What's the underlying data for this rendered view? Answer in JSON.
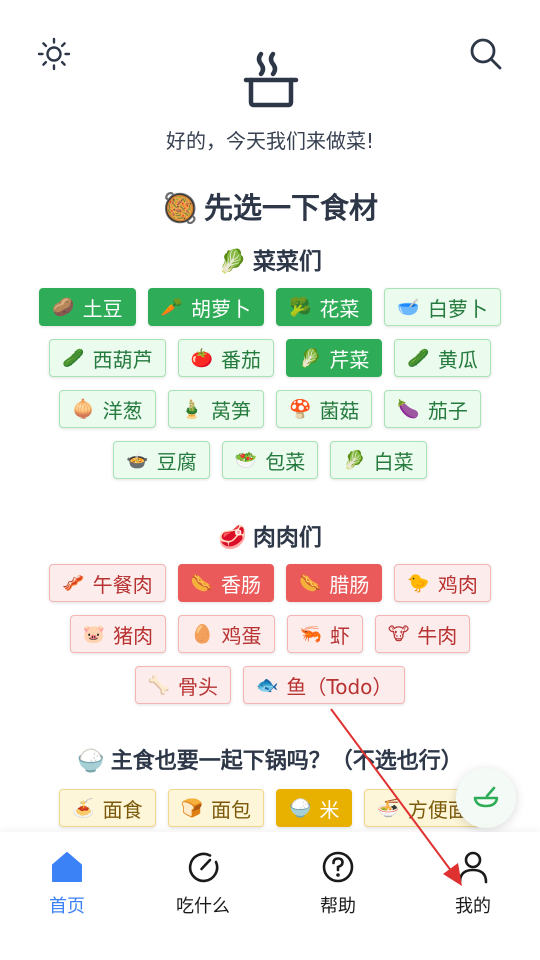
{
  "app": {
    "subtitle": "好的，今天我们来做菜!",
    "choose_title": "先选一下食材",
    "choose_emoji": "🥘"
  },
  "icons": {
    "top_left": "sun-icon",
    "top_right": "search-icon",
    "logo": "cooking-pot-icon",
    "fab": "bowl-icon"
  },
  "sections": {
    "veg": {
      "title": "菜菜们",
      "emoji": "🥬",
      "rows": [
        [
          {
            "emoji": "🥔",
            "label": "土豆",
            "selected": true
          },
          {
            "emoji": "🥕",
            "label": "胡萝卜",
            "selected": true
          },
          {
            "emoji": "🥦",
            "label": "花菜",
            "selected": true
          },
          {
            "emoji": "🥣",
            "label": "白萝卜",
            "selected": false
          }
        ],
        [
          {
            "emoji": "🥒",
            "label": "西葫芦",
            "selected": false
          },
          {
            "emoji": "🍅",
            "label": "番茄",
            "selected": false
          },
          {
            "emoji": "🥬",
            "label": "芹菜",
            "selected": true
          },
          {
            "emoji": "🥒",
            "label": "黄瓜",
            "selected": false
          }
        ],
        [
          {
            "emoji": "🧅",
            "label": "洋葱",
            "selected": false
          },
          {
            "emoji": "🎍",
            "label": "莴笋",
            "selected": false
          },
          {
            "emoji": "🍄",
            "label": "菌菇",
            "selected": false
          },
          {
            "emoji": "🍆",
            "label": "茄子",
            "selected": false
          }
        ],
        [
          {
            "emoji": "🍲",
            "label": "豆腐",
            "selected": false
          },
          {
            "emoji": "🥗",
            "label": "包菜",
            "selected": false
          },
          {
            "emoji": "🥬",
            "label": "白菜",
            "selected": false
          }
        ]
      ]
    },
    "meat": {
      "title": "肉肉们",
      "emoji": "🥩",
      "rows": [
        [
          {
            "emoji": "🥓",
            "label": "午餐肉",
            "selected": false
          },
          {
            "emoji": "🌭",
            "label": "香肠",
            "selected": true
          },
          {
            "emoji": "🌭",
            "label": "腊肠",
            "selected": true
          },
          {
            "emoji": "🐤",
            "label": "鸡肉",
            "selected": false
          }
        ],
        [
          {
            "emoji": "🐷",
            "label": "猪肉",
            "selected": false
          },
          {
            "emoji": "🥚",
            "label": "鸡蛋",
            "selected": false
          },
          {
            "emoji": "🦐",
            "label": "虾",
            "selected": false
          },
          {
            "emoji": "🐮",
            "label": "牛肉",
            "selected": false
          }
        ],
        [
          {
            "emoji": "🦴",
            "label": "骨头",
            "selected": false
          },
          {
            "emoji": "🐟",
            "label": "鱼（Todo）",
            "selected": false
          }
        ]
      ]
    },
    "staple": {
      "title": "主食也要一起下锅吗？（不选也行）",
      "emoji": "🍚",
      "rows": [
        [
          {
            "emoji": "🍝",
            "label": "面食",
            "selected": false
          },
          {
            "emoji": "🍞",
            "label": "面包",
            "selected": false
          },
          {
            "emoji": "🍚",
            "label": "米",
            "selected": true
          },
          {
            "emoji": "🍜",
            "label": "方便面",
            "selected": false
          }
        ]
      ]
    }
  },
  "tabs": [
    {
      "label": "首页",
      "icon": "home-icon",
      "active": true
    },
    {
      "label": "吃什么",
      "icon": "compass-icon",
      "active": false
    },
    {
      "label": "帮助",
      "icon": "help-icon",
      "active": false
    },
    {
      "label": "我的",
      "icon": "user-icon",
      "active": false
    }
  ],
  "colors": {
    "accent": "#3b82f6",
    "veg_selected": "#2fac57",
    "meat_selected": "#ea5a5a",
    "staple_selected": "#e8b100",
    "arrow": "#e03131"
  }
}
